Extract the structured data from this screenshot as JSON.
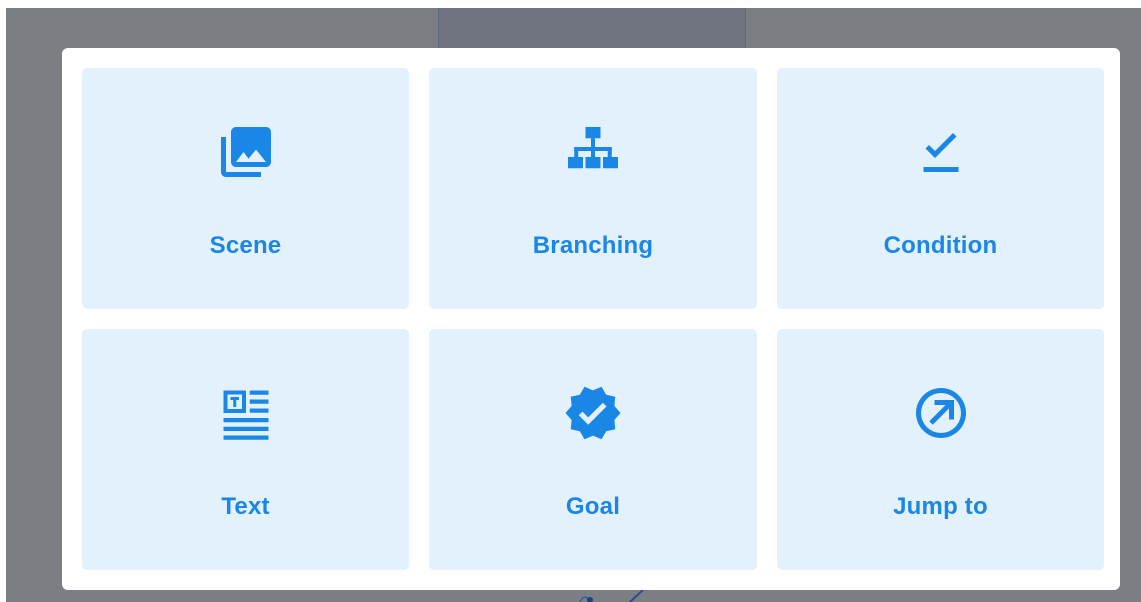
{
  "modal": {
    "tiles": [
      {
        "label": "Scene",
        "icon": "photo-library-icon"
      },
      {
        "label": "Branching",
        "icon": "hierarchy-icon"
      },
      {
        "label": "Condition",
        "icon": "check-underline-icon"
      },
      {
        "label": "Text",
        "icon": "text-article-icon"
      },
      {
        "label": "Goal",
        "icon": "verified-badge-icon"
      },
      {
        "label": "Jump to",
        "icon": "arrow-circle-icon"
      }
    ]
  },
  "colors": {
    "tile_background": "#e3f1fd",
    "accent": "#1a86e6",
    "overlay": "#7b7f84",
    "modal_background": "#ffffff"
  }
}
